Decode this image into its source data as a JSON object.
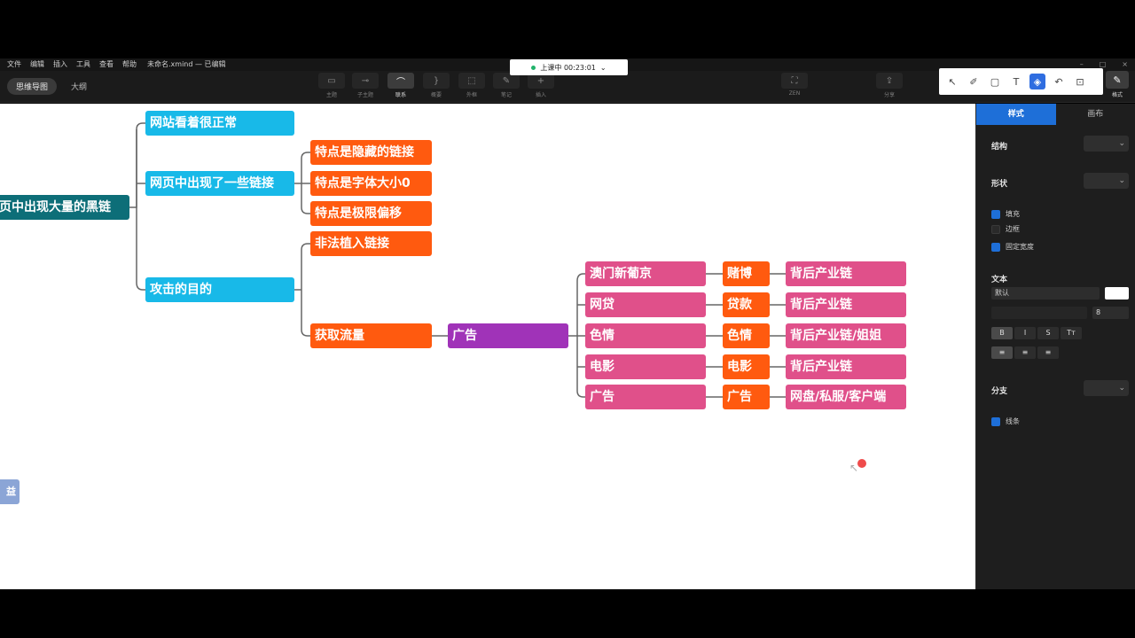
{
  "menu": {
    "items": [
      "文件",
      "编辑",
      "插入",
      "工具",
      "查看",
      "帮助"
    ],
    "doc_title": "未命名.xmind — 已编辑"
  },
  "view_tabs": [
    "思维导图",
    "大纲"
  ],
  "tools": [
    {
      "name": "topic",
      "label": "主题",
      "icon": "▭"
    },
    {
      "name": "subtopic",
      "label": "子主题",
      "icon": "⊸"
    },
    {
      "name": "relationship",
      "label": "联系",
      "icon": "⌒"
    },
    {
      "name": "summary",
      "label": "概要",
      "icon": "}"
    },
    {
      "name": "boundary",
      "label": "外框",
      "icon": "⬚"
    },
    {
      "name": "note",
      "label": "笔记",
      "icon": "✎"
    },
    {
      "name": "insert",
      "label": "插入",
      "icon": "+"
    }
  ],
  "zen": {
    "label": "ZEN",
    "icon": "⛶"
  },
  "share": {
    "label": "分享",
    "icon": "⇪"
  },
  "recording": {
    "text": "上课中 00:23:01",
    "chevron": "⌄"
  },
  "annotation_tools": [
    "↖",
    "✐",
    "▢",
    "T",
    "◈",
    "↶",
    "⊡"
  ],
  "format_button": {
    "label": "格式",
    "icon": "✎"
  },
  "mindmap": {
    "root": "页中出现大量的黑链",
    "branches": [
      {
        "text": "网站看着很正常"
      },
      {
        "text": "网页中出现了一些链接",
        "children": [
          "特点是隐藏的链接",
          "特点是字体大小0",
          "特点是极限偏移"
        ]
      },
      {
        "text": "攻击的目的",
        "children": [
          "非法植入链接",
          "获取流量"
        ]
      }
    ],
    "ad": "广告",
    "rows": [
      {
        "a": "澳门新葡京",
        "b": "赌博",
        "c": "背后产业链"
      },
      {
        "a": "网贷",
        "b": "贷款",
        "c": "背后产业链"
      },
      {
        "a": "色情",
        "b": "色情",
        "c": "背后产业链/姐姐"
      },
      {
        "a": "电影",
        "b": "电影",
        "c": "背后产业链"
      },
      {
        "a": "广告",
        "b": "广告",
        "c": "网盘/私服/客户端"
      }
    ],
    "partial_node": "益"
  },
  "panel": {
    "tabs": [
      "样式",
      "画布"
    ],
    "structure_label": "结构",
    "shape_label": "形状",
    "fill_label": "填充",
    "border_label": "边框",
    "fixed_width_label": "固定宽度",
    "text_label": "文本",
    "font_value": "默认",
    "font_size": "8",
    "style_buttons": [
      "B",
      "I",
      "S",
      "Tт"
    ],
    "align_buttons": [
      "≡",
      "≡",
      "≡"
    ],
    "branch_label": "分支",
    "line_label": "线条"
  },
  "colors": {
    "root": "#0d6e78",
    "level1": "#18b9e8",
    "level2": "#ff5a0f",
    "ad": "#a033b8",
    "leaf": "#e0508a",
    "accent": "#1e6fd8"
  }
}
